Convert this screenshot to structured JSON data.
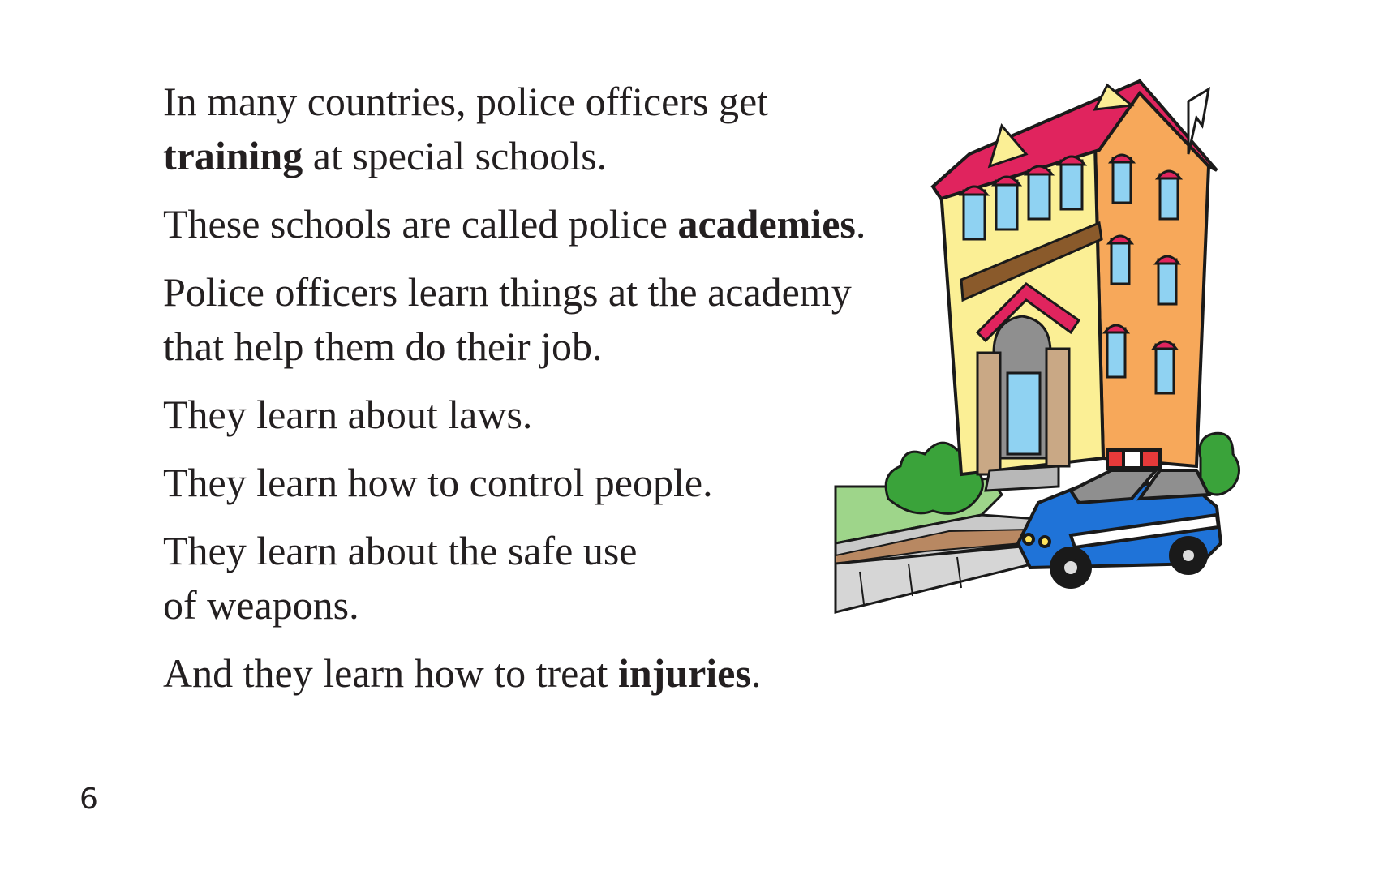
{
  "page": {
    "paragraphs": [
      {
        "line1": "In many countries, police officers get",
        "bold": "training",
        "rest": " at special schools."
      },
      {
        "before": "These schools are called police ",
        "bold": "academies",
        "after": "."
      },
      {
        "line1": "Police officers learn things at the academy",
        "line2": "that help them do their job."
      },
      {
        "text": "They learn about laws."
      },
      {
        "text": "They learn how to control people."
      },
      {
        "line1": "They learn about the safe use",
        "line2": "of weapons."
      },
      {
        "before": "And they learn how to treat ",
        "bold": "injuries",
        "after": "."
      }
    ],
    "page_number": "6"
  },
  "illustration": {
    "subject": "police academy building with police car",
    "colors": {
      "roof": "#e0245e",
      "wall_front": "#fbef95",
      "wall_side": "#f7a85a",
      "window": "#8fd2f2",
      "trim": "#8a5a2b",
      "car": "#1f73d8",
      "lightbar": "#e63a3a",
      "grass": "#9ed58a",
      "bush": "#3aa33a",
      "sidewalk": "#c9c9c9",
      "door_arch": "#8f8f8f"
    }
  }
}
